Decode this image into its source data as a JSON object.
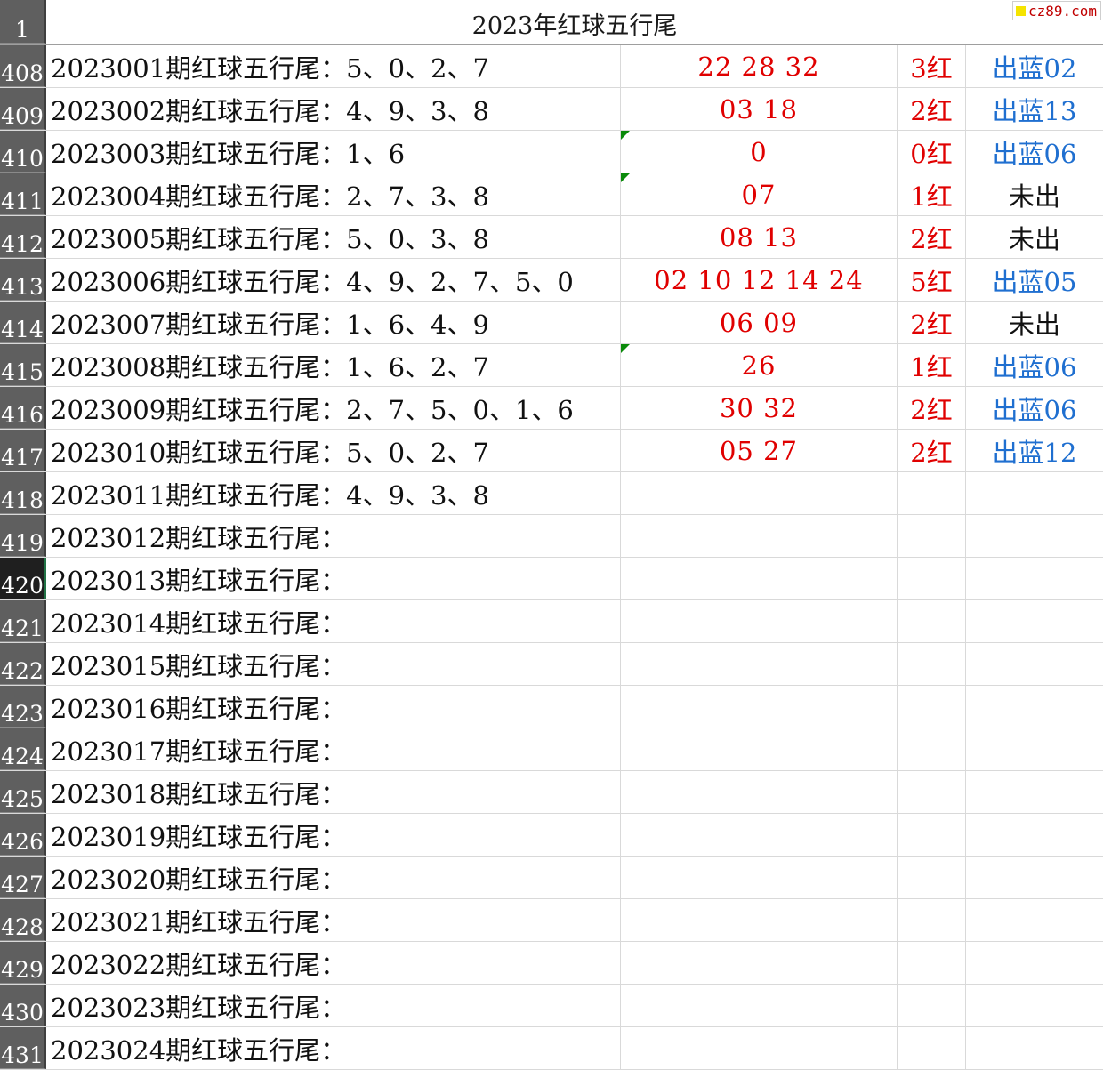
{
  "sheet_title": "2023年红球五行尾",
  "watermark": "cz89.com",
  "header_row": "1",
  "rows": [
    {
      "num": "408",
      "a": "2023001期红球五行尾：5、0、2、7",
      "b": "22  28  32",
      "c": "3红",
      "d": "出蓝02",
      "d_style": "blue"
    },
    {
      "num": "409",
      "a": "2023002期红球五行尾：4、9、3、8",
      "b": "03  18",
      "c": "2红",
      "d": "出蓝13",
      "d_style": "blue"
    },
    {
      "num": "410",
      "a": "2023003期红球五行尾：1、6",
      "b": "0",
      "c": "0红",
      "d": "出蓝06",
      "d_style": "blue",
      "flag": true
    },
    {
      "num": "411",
      "a": "2023004期红球五行尾：2、7、3、8",
      "b": "07",
      "c": "1红",
      "d": "未出",
      "d_style": "black",
      "flag": true
    },
    {
      "num": "412",
      "a": "2023005期红球五行尾：5、0、3、8",
      "b": "08  13",
      "c": "2红",
      "d": "未出",
      "d_style": "black"
    },
    {
      "num": "413",
      "a": "2023006期红球五行尾：4、9、2、7、5、0",
      "b": "02  10  12  14  24",
      "c": "5红",
      "d": "出蓝05",
      "d_style": "blue"
    },
    {
      "num": "414",
      "a": "2023007期红球五行尾：1、6、4、9",
      "b": "06  09",
      "c": "2红",
      "d": "未出",
      "d_style": "black"
    },
    {
      "num": "415",
      "a": "2023008期红球五行尾：1、6、2、7",
      "b": "26",
      "c": "1红",
      "d": "出蓝06",
      "d_style": "blue",
      "flag": true
    },
    {
      "num": "416",
      "a": "2023009期红球五行尾：2、7、5、0、1、6",
      "b": "30  32",
      "c": "2红",
      "d": "出蓝06",
      "d_style": "blue"
    },
    {
      "num": "417",
      "a": "2023010期红球五行尾：5、0、2、7",
      "b": "05  27",
      "c": "2红",
      "d": "出蓝12",
      "d_style": "blue"
    },
    {
      "num": "418",
      "a": "2023011期红球五行尾：4、9、3、8",
      "b": "",
      "c": "",
      "d": ""
    },
    {
      "num": "419",
      "a": "2023012期红球五行尾：",
      "b": "",
      "c": "",
      "d": ""
    },
    {
      "num": "420",
      "a": "2023013期红球五行尾：",
      "b": "",
      "c": "",
      "d": "",
      "active": true
    },
    {
      "num": "421",
      "a": "2023014期红球五行尾：",
      "b": "",
      "c": "",
      "d": ""
    },
    {
      "num": "422",
      "a": "2023015期红球五行尾：",
      "b": "",
      "c": "",
      "d": ""
    },
    {
      "num": "423",
      "a": "2023016期红球五行尾：",
      "b": "",
      "c": "",
      "d": ""
    },
    {
      "num": "424",
      "a": "2023017期红球五行尾：",
      "b": "",
      "c": "",
      "d": ""
    },
    {
      "num": "425",
      "a": "2023018期红球五行尾：",
      "b": "",
      "c": "",
      "d": ""
    },
    {
      "num": "426",
      "a": "2023019期红球五行尾：",
      "b": "",
      "c": "",
      "d": ""
    },
    {
      "num": "427",
      "a": "2023020期红球五行尾：",
      "b": "",
      "c": "",
      "d": ""
    },
    {
      "num": "428",
      "a": "2023021期红球五行尾：",
      "b": "",
      "c": "",
      "d": ""
    },
    {
      "num": "429",
      "a": "2023022期红球五行尾：",
      "b": "",
      "c": "",
      "d": ""
    },
    {
      "num": "430",
      "a": "2023023期红球五行尾：",
      "b": "",
      "c": "",
      "d": ""
    },
    {
      "num": "431",
      "a": "2023024期红球五行尾：",
      "b": "",
      "c": "",
      "d": ""
    }
  ]
}
